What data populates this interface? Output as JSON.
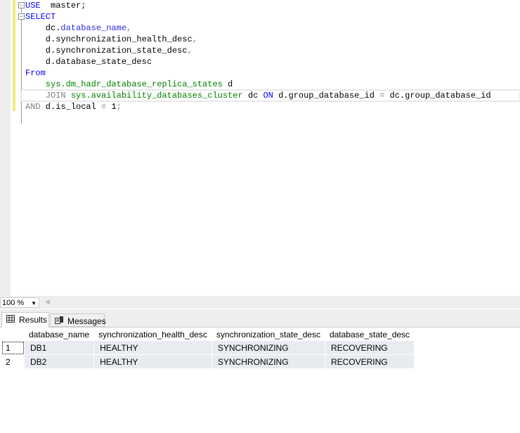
{
  "editor": {
    "lines": [
      [
        [
          "kw",
          "USE"
        ],
        [
          "",
          "  "
        ],
        [
          "",
          "master;"
        ]
      ],
      [
        [
          "kw",
          "SELECT"
        ]
      ],
      [
        [
          "",
          "    dc."
        ],
        [
          "col",
          "database_name"
        ],
        [
          "gray",
          ","
        ]
      ],
      [
        [
          "",
          "    d.synchronization_health_desc"
        ],
        [
          "gray",
          ","
        ]
      ],
      [
        [
          "",
          "    d.synchronization_state_desc"
        ],
        [
          "gray",
          ","
        ]
      ],
      [
        [
          "",
          "    d.database_state_desc"
        ]
      ],
      [
        [
          "kw",
          "From"
        ]
      ],
      [
        [
          "sys",
          "    sys.dm_hadr_database_replica_states"
        ],
        [
          "",
          " d"
        ]
      ],
      [
        [
          "gray",
          "    JOIN "
        ],
        [
          "sys",
          "sys.availability_databases_cluster"
        ],
        [
          "",
          " dc "
        ],
        [
          "kw",
          "ON"
        ],
        [
          "",
          " d.group_database_id "
        ],
        [
          "gray",
          "="
        ],
        [
          "",
          " dc.group_database_id"
        ]
      ],
      [
        [
          "gray",
          "AND"
        ],
        [
          "",
          " d.is_local "
        ],
        [
          "gray",
          "="
        ],
        [
          "",
          " 1"
        ],
        [
          "gray",
          ";"
        ]
      ]
    ]
  },
  "zoom": {
    "value": "100 %"
  },
  "tabs": {
    "results": "Results",
    "messages": "Messages"
  },
  "grid": {
    "columns": [
      "database_name",
      "synchronization_health_desc",
      "synchronization_state_desc",
      "database_state_desc"
    ],
    "rows": [
      {
        "n": "1",
        "cells": [
          "DB1",
          "HEALTHY",
          "SYNCHRONIZING",
          "RECOVERING"
        ]
      },
      {
        "n": "2",
        "cells": [
          "DB2",
          "HEALTHY",
          "SYNCHRONIZING",
          "RECOVERING"
        ]
      }
    ]
  }
}
